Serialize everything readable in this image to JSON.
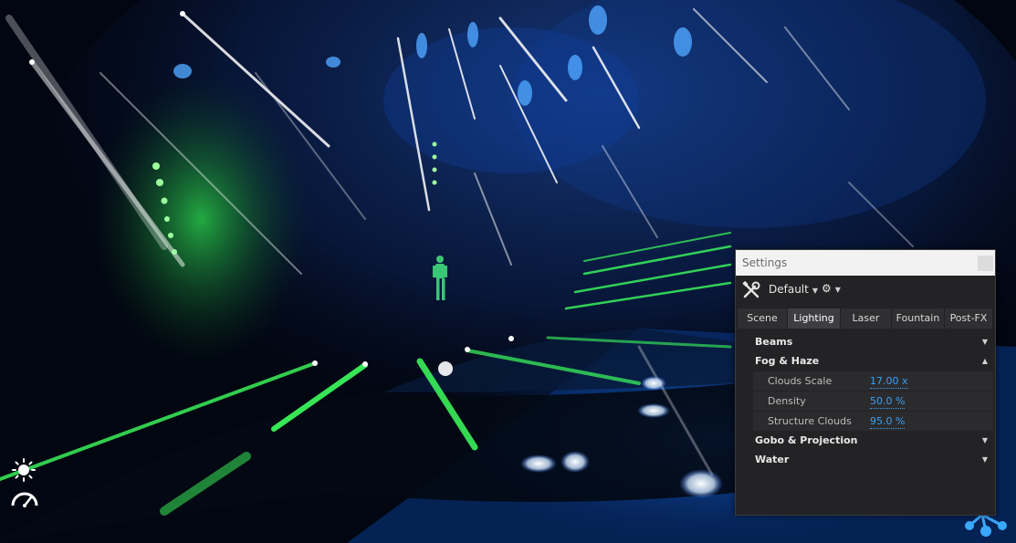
{
  "settings_panel": {
    "title": "Settings",
    "preset": "Default",
    "tabs": [
      {
        "label": "Scene",
        "active": false
      },
      {
        "label": "Lighting",
        "active": true
      },
      {
        "label": "Laser",
        "active": false
      },
      {
        "label": "Fountain",
        "active": false
      },
      {
        "label": "Post-FX",
        "active": false
      }
    ],
    "sections": {
      "beams": {
        "label": "Beams",
        "expanded": false
      },
      "fog": {
        "label": "Fog & Haze",
        "expanded": true
      },
      "gobo": {
        "label": "Gobo & Projection",
        "expanded": false
      },
      "water": {
        "label": "Water",
        "expanded": false
      }
    },
    "fog_settings": [
      {
        "label": "Clouds Scale",
        "value": "17.00 x"
      },
      {
        "label": "Density",
        "value": "50.0 %"
      },
      {
        "label": "Structure Clouds",
        "value": "95.0 %"
      }
    ]
  },
  "hud": {
    "icons": [
      "sun-icon",
      "speedometer-icon",
      "network-logo-icon"
    ]
  },
  "colors": {
    "accent_value": "#3aa0f2",
    "stage_green": "#37ff5a",
    "stage_blue": "#1a66ff"
  }
}
